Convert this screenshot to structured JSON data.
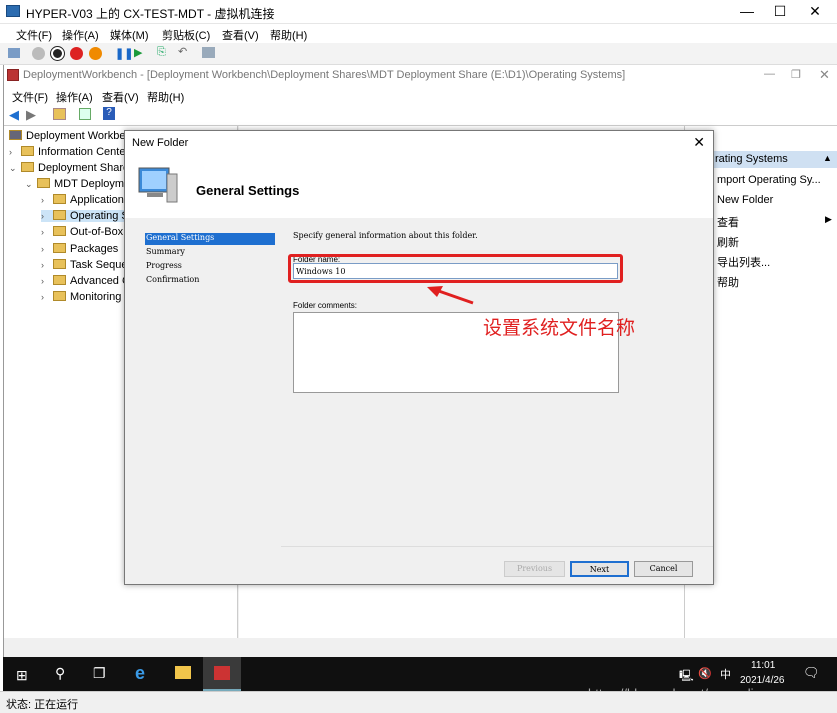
{
  "hyperv": {
    "title": "HYPER-V03 上的 CX-TEST-MDT - 虚拟机连接",
    "menu": [
      "文件(F)",
      "操作(A)",
      "媒体(M)",
      "剪贴板(C)",
      "查看(V)",
      "帮助(H)"
    ],
    "status": "状态: 正在运行"
  },
  "mmc": {
    "title": "DeploymentWorkbench - [Deployment Workbench\\Deployment Shares\\MDT Deployment Share (E:\\D1)\\Operating Systems]",
    "menu": [
      "文件(F)",
      "操作(A)",
      "查看(V)",
      "帮助(H)"
    ]
  },
  "tree": {
    "items": [
      "Deployment Workbe",
      "Information Cente",
      "Deployment Share",
      "MDT Deploym",
      "Application",
      "Operating S",
      "Out-of-Box",
      "Packages",
      "Task Seque",
      "Advanced C",
      "Monitoring"
    ]
  },
  "actions": {
    "header": "rating Systems",
    "items": [
      "mport Operating Sy...",
      "New Folder",
      "查看",
      "刷新",
      "导出列表...",
      "帮助"
    ]
  },
  "dialog": {
    "title": "New Folder",
    "heading": "General Settings",
    "nav": [
      "General Settings",
      "Summary",
      "Progress",
      "Confirmation"
    ],
    "instruction": "Specify general information about this folder.",
    "folder_name_label": "Folder name:",
    "folder_name_value": "Windows 10",
    "comments_label": "Folder comments:",
    "buttons": {
      "previous": "Previous",
      "next": "Next",
      "cancel": "Cancel"
    }
  },
  "annotation": {
    "text": "设置系统文件名称",
    "color": "#e02020"
  },
  "taskbar": {
    "time": "11:01",
    "date": "2021/4/26",
    "ime": "中"
  },
  "watermark": "https://blog.csdn.net/cxxuzcli"
}
